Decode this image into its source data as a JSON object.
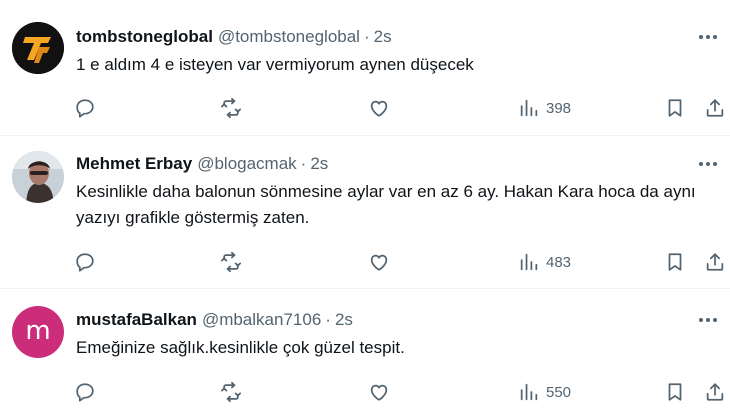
{
  "tweets": [
    {
      "display_name": "tombstoneglobal",
      "handle": "@tombstoneglobal",
      "separator": "·",
      "time": "2s",
      "text": "1 e aldım 4 e isteyen var vermiyorum aynen düşecek",
      "views": "398",
      "avatar": "logo-icon"
    },
    {
      "display_name": "Mehmet Erbay",
      "handle": "@blogacmak",
      "separator": "·",
      "time": "2s",
      "text": "Kesinlikle daha balonun sönmesine aylar var en az 6 ay. Hakan Kara hoca da aynı yazıyı grafikle göstermiş zaten.",
      "views": "483",
      "avatar": "profile-photo"
    },
    {
      "display_name": "mustafaBalkan",
      "handle": "@mbalkan7106",
      "separator": "·",
      "time": "2s",
      "text": "Emeğinize sağlık.kesinlikle çok güzel tespit.",
      "views": "550",
      "avatar_letter": "m",
      "avatar_color": "#cc2d7a"
    }
  ],
  "colors": {
    "text_primary": "#0f1419",
    "text_secondary": "#536471",
    "divider": "#eff3f4",
    "logo_accent": "#f5a623"
  },
  "icons": [
    "more-icon",
    "reply-icon",
    "retweet-icon",
    "like-icon",
    "views-icon",
    "bookmark-icon",
    "share-icon"
  ]
}
